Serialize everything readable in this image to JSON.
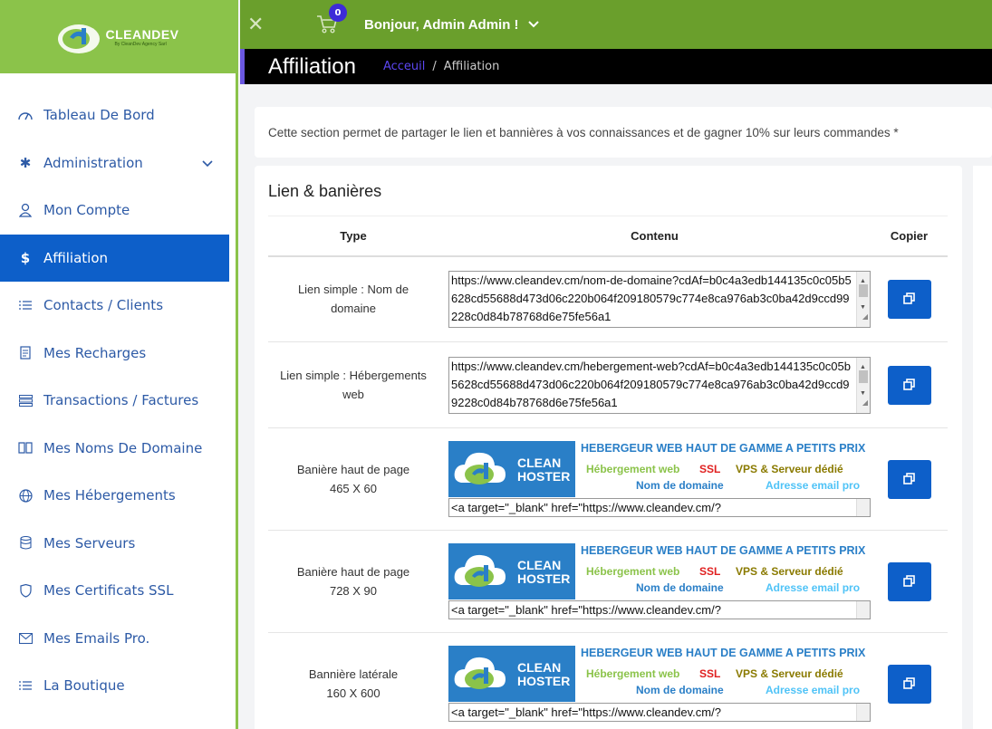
{
  "brand": {
    "name": "CLEANDEV",
    "tagline": "By CleanDev Agency Sarl"
  },
  "topbar": {
    "cart_count": "0",
    "greeting": "Bonjour, Admin Admin !"
  },
  "sidebar": {
    "items": [
      {
        "label": "Tableau De Bord",
        "icon": "dashboard-icon"
      },
      {
        "label": "Administration",
        "icon": "gear-icon"
      },
      {
        "label": "Mon Compte",
        "icon": "user-icon"
      },
      {
        "label": "Affiliation",
        "icon": "dollar-icon"
      },
      {
        "label": "Contacts / Clients",
        "icon": "list-icon"
      },
      {
        "label": "Mes Recharges",
        "icon": "receipt-icon"
      },
      {
        "label": "Transactions / Factures",
        "icon": "rows-icon"
      },
      {
        "label": "Mes Noms De Domaine",
        "icon": "book-icon"
      },
      {
        "label": "Mes Hébergements",
        "icon": "globe-icon"
      },
      {
        "label": "Mes Serveurs",
        "icon": "database-icon"
      },
      {
        "label": "Mes Certificats SSL",
        "icon": "shield-icon"
      },
      {
        "label": "Mes Emails Pro.",
        "icon": "mail-icon"
      },
      {
        "label": "La Boutique",
        "icon": "list-icon"
      }
    ]
  },
  "page": {
    "title": "Affiliation",
    "breadcrumb": {
      "home": "Acceuil",
      "sep": "/",
      "current": "Affiliation"
    },
    "info": "Cette section permet de partager le lien et bannières à vos connaissances et de gagner 10% sur leurs commandes *"
  },
  "card": {
    "title": "Lien & banières",
    "headers": {
      "type": "Type",
      "content": "Contenu",
      "copy": "Copier"
    },
    "rows": [
      {
        "type": "Lien simple : Nom de domaine",
        "content": "https://www.cleandev.cm/nom-de-domaine?cdAf=b0c4a3edb144135c0c05b5628cd55688d473d06c220b064f209180579c774e8ca976ab3c0ba42d9ccd99228c0d84b78768d6e75fe56a1"
      },
      {
        "type": "Lien simple : Hébergements web",
        "content": "https://www.cleandev.cm/hebergement-web?cdAf=b0c4a3edb144135c0c05b5628cd55688d473d06c220b064f209180579c774e8ca976ab3c0ba42d9ccd99228c0d84b78768d6e75fe56a1"
      },
      {
        "type": "Banière haut de page",
        "size": "465 X 60",
        "code": "<a target=\"_blank\" href=\"https://www.cleandev.cm/?"
      },
      {
        "type": "Banière haut de page",
        "size": "728 X 90",
        "code": "<a target=\"_blank\" href=\"https://www.cleandev.cm/?"
      },
      {
        "type": "Bannière latérale",
        "size": "160 X 600",
        "code": "<a target=\"_blank\" href=\"https://www.cleandev.cm/?"
      }
    ]
  },
  "banner": {
    "brand_line1": "CLEAN",
    "brand_line2": "HOSTER",
    "title": "HEBERGEUR WEB HAUT DE GAMME A PETITS PRIX",
    "hosting": "Hébergement web",
    "ssl": "SSL",
    "vps": "VPS & Serveur dédié",
    "domain": "Nom de domaine",
    "email": "Adresse email pro"
  }
}
